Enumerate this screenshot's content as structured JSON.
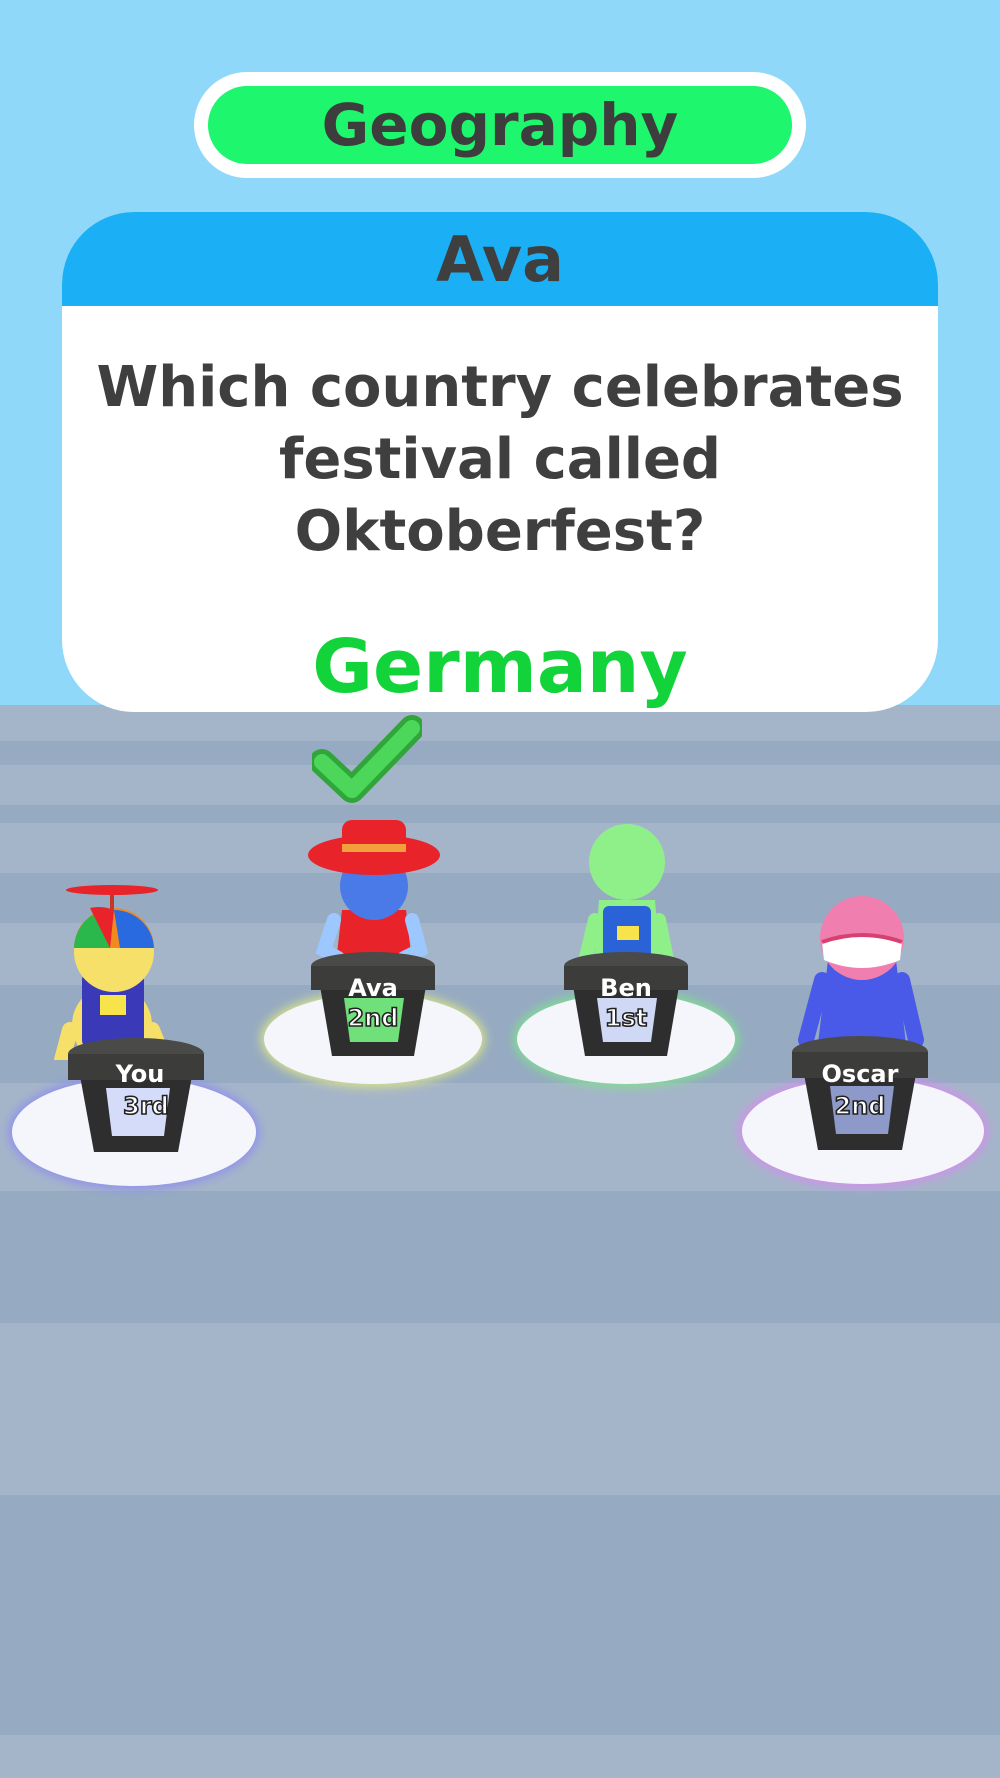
{
  "category": {
    "label": "Geography",
    "color": "#1ef66d"
  },
  "question_card": {
    "asker": "Ava",
    "question_lines": [
      "Which country celebrates",
      "festival called",
      "Oktoberfest?"
    ],
    "answer": "Germany",
    "header_color": "#1bb0f5",
    "answer_color": "#12d43a"
  },
  "correct_marker": {
    "icon": "checkmark-icon",
    "player": "Ava"
  },
  "players": [
    {
      "name": "You",
      "rank": "3rd",
      "hat": "propeller-cap",
      "ring_glow": "#8f8ff0",
      "panel_color": "#d4dcfa"
    },
    {
      "name": "Ava",
      "rank": "2nd",
      "hat": "red-sun-hat",
      "ring_glow": "#d9e28a",
      "panel_color": "#6fe07a"
    },
    {
      "name": "Ben",
      "rank": "1st",
      "hat": "none",
      "ring_glow": "#7fe08f",
      "panel_color": "#cfd9f6"
    },
    {
      "name": "Oscar",
      "rank": "2nd",
      "hat": "pink-mask",
      "ring_glow": "#d58ef0",
      "panel_color": "#8d9ac9"
    }
  ]
}
